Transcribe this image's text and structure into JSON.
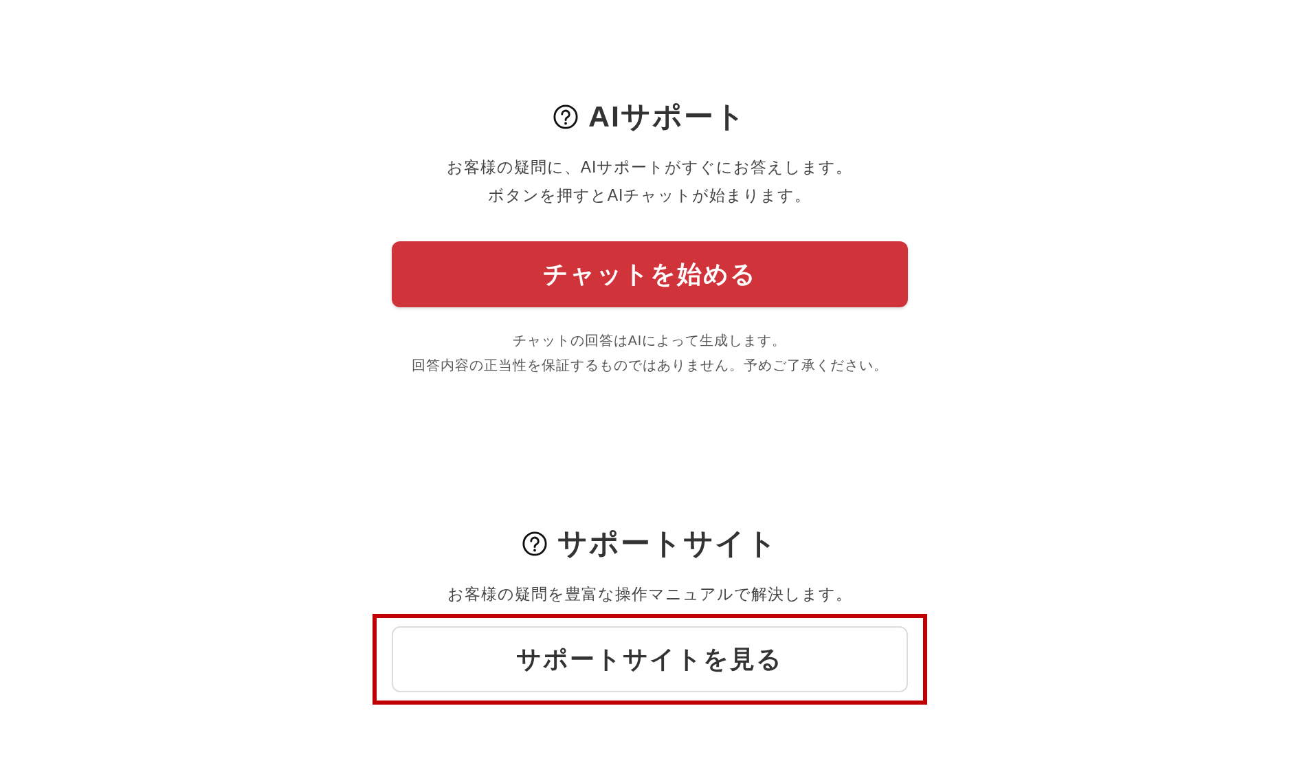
{
  "sections": [
    {
      "title": "AIサポート",
      "description": [
        "お客様の疑問に、AIサポートがすぐにお答えします。",
        "ボタンを押すとAIチャットが始まります。"
      ],
      "button": {
        "label": "チャットを始める",
        "kind": "primary",
        "highlighted": false
      },
      "notes": [
        "チャットの回答はAIによって生成します。",
        "回答内容の正当性を保証するものではありません。予めご了承ください。"
      ]
    },
    {
      "title": "サポートサイト",
      "description": [
        "お客様の疑問を豊富な操作マニュアルで解決します。"
      ],
      "button": {
        "label": "サポートサイトを見る",
        "kind": "secondary",
        "highlighted": true
      }
    }
  ]
}
